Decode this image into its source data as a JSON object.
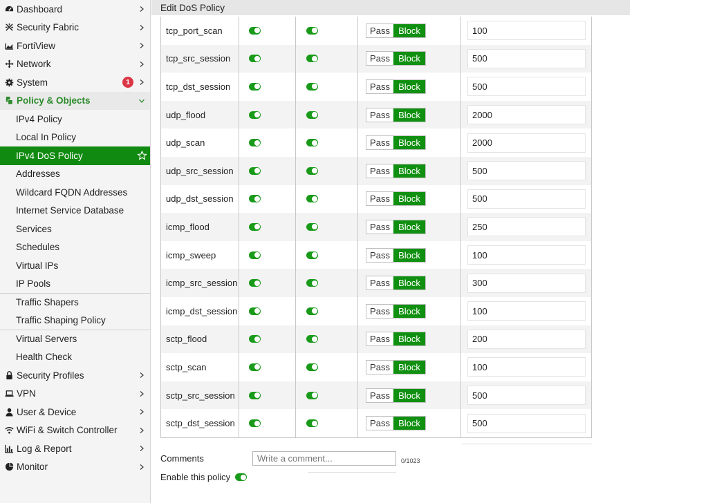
{
  "colors": {
    "accent_green": "#108a10",
    "badge_red": "#dc3545"
  },
  "sidebar": {
    "top_items": [
      {
        "label": "Dashboard",
        "icon": "dashboard-icon"
      },
      {
        "label": "Security Fabric",
        "icon": "security-fabric-icon"
      },
      {
        "label": "FortiView",
        "icon": "fortiview-chart-icon"
      },
      {
        "label": "Network",
        "icon": "network-arrows-icon"
      },
      {
        "label": "System",
        "icon": "gear-icon",
        "badge": "1"
      }
    ],
    "open_section": {
      "label": "Policy & Objects",
      "icon": "policy-objects-icon"
    },
    "sub_items": [
      "IPv4 Policy",
      "Local In Policy",
      "IPv4 DoS Policy",
      "Addresses",
      "Wildcard FQDN Addresses",
      "Internet Service Database",
      "Services",
      "Schedules",
      "Virtual IPs",
      "IP Pools",
      "Traffic Shapers",
      "Traffic Shaping Policy",
      "Virtual Servers",
      "Health Check"
    ],
    "bottom_items": [
      {
        "label": "Security Profiles",
        "icon": "lock-icon"
      },
      {
        "label": "VPN",
        "icon": "laptop-icon"
      },
      {
        "label": "User & Device",
        "icon": "user-icon"
      },
      {
        "label": "WiFi & Switch Controller",
        "icon": "wifi-icon"
      },
      {
        "label": "Log & Report",
        "icon": "bar-chart-icon"
      },
      {
        "label": "Monitor",
        "icon": "pie-chart-icon"
      }
    ]
  },
  "header": {
    "title": "Edit DoS Policy"
  },
  "table": {
    "pass_label": "Pass",
    "block_label": "Block",
    "rows": [
      {
        "name": "tcp_port_scan",
        "threshold": "100"
      },
      {
        "name": "tcp_src_session",
        "threshold": "500"
      },
      {
        "name": "tcp_dst_session",
        "threshold": "500"
      },
      {
        "name": "udp_flood",
        "threshold": "2000"
      },
      {
        "name": "udp_scan",
        "threshold": "2000"
      },
      {
        "name": "udp_src_session",
        "threshold": "500"
      },
      {
        "name": "udp_dst_session",
        "threshold": "500"
      },
      {
        "name": "icmp_flood",
        "threshold": "250"
      },
      {
        "name": "icmp_sweep",
        "threshold": "100"
      },
      {
        "name": "icmp_src_session",
        "threshold": "300"
      },
      {
        "name": "icmp_dst_session",
        "threshold": "100"
      },
      {
        "name": "sctp_flood",
        "threshold": "200"
      },
      {
        "name": "sctp_scan",
        "threshold": "100"
      },
      {
        "name": "sctp_src_session",
        "threshold": "500"
      },
      {
        "name": "sctp_dst_session",
        "threshold": "500"
      }
    ]
  },
  "footer": {
    "comments_label": "Comments",
    "comment_placeholder": "Write a comment...",
    "char_count": "0/1023",
    "enable_label": "Enable this policy"
  }
}
